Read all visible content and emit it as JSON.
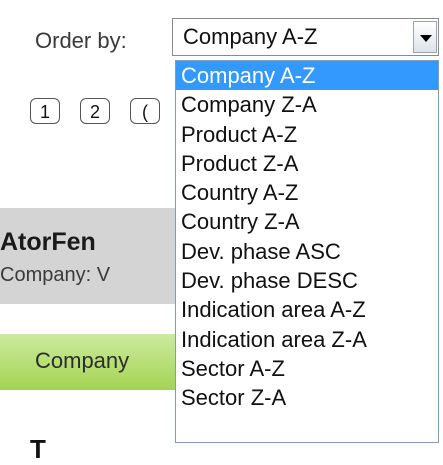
{
  "order_by": {
    "label": "Order by:",
    "selected_value": "Company A-Z",
    "options": [
      "Company A-Z",
      "Company Z-A",
      "Product A-Z",
      "Product Z-A",
      "Country A-Z",
      "Country Z-A",
      "Dev. phase ASC",
      "Dev. phase DESC",
      "Indication area A-Z",
      "Indication area Z-A",
      "Sector A-Z",
      "Sector Z-A"
    ],
    "highlighted_index": 0
  },
  "pager": {
    "pages": [
      "1",
      "2",
      "("
    ]
  },
  "card": {
    "title": "AtorFen",
    "subtitle": "Company: V"
  },
  "tab": {
    "label": "Company"
  },
  "bottom": {
    "text": "T"
  },
  "colors": {
    "highlight": "#3399ff",
    "green": "#a4d452",
    "band": "#d4d4d4"
  }
}
